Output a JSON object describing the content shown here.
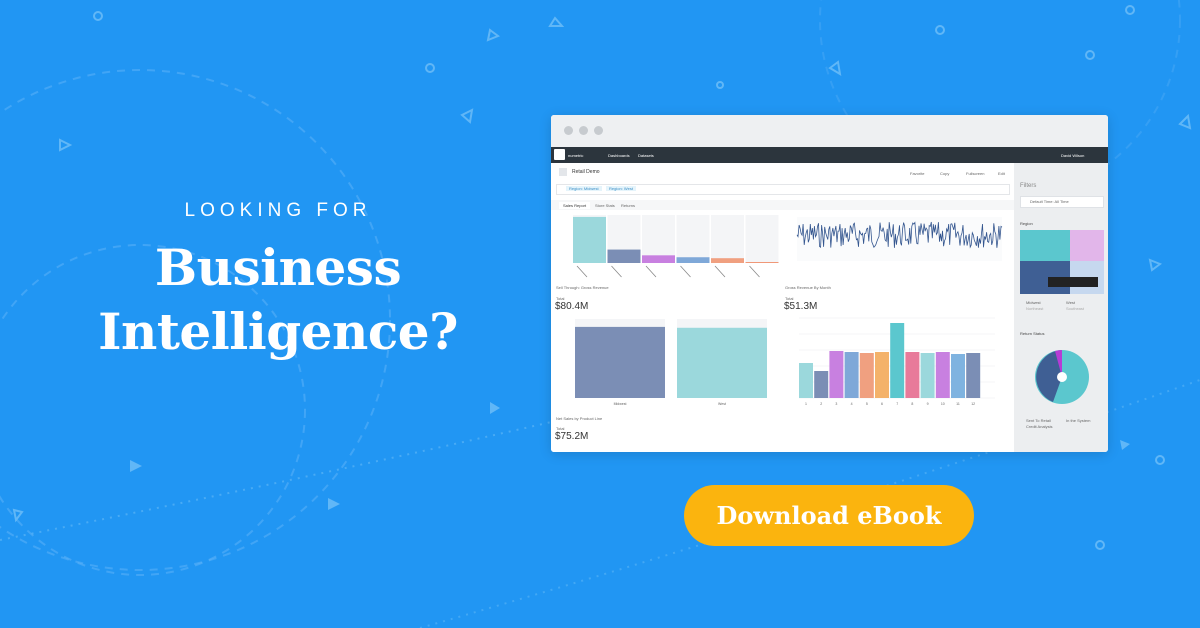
{
  "hero": {
    "kicker": "LOOKING FOR",
    "title_line1": "Business",
    "title_line2": "Intelligence?"
  },
  "cta": {
    "label": "Download eBook"
  },
  "app": {
    "brand": "numetric",
    "nav": [
      "Dashboards",
      "Datasets"
    ],
    "user": "David Wilson",
    "dashboard_title": "Retail Demo",
    "actions": [
      "Favorite",
      "Copy",
      "Fullscreen",
      "Edit"
    ],
    "filter_chips": [
      "Region: Midwest",
      "Region: West"
    ],
    "tabs": [
      "Sales Report",
      "Store Stats",
      "Returns"
    ],
    "charts": {
      "sell_through": {
        "title": "Sell Through: Gross Revenue",
        "total_label": "Total",
        "total": "$80.4M"
      },
      "gross_by_month": {
        "title": "Gross Revenue By Month",
        "total_label": "Total",
        "total": "$51.3M"
      },
      "net_sales": {
        "title": "Net Sales by Product Line",
        "total_label": "Total",
        "total": "$75.2M"
      }
    },
    "sidebar": {
      "panel_title": "Filters",
      "range": "Default Time: All Time",
      "section1": "Region",
      "section2": "Return Status",
      "legend1": [
        "Midwest",
        "West",
        "Northeast",
        "Southeast"
      ],
      "legend2": [
        "Sent To Retail",
        "In the System",
        "Credit Analysis"
      ]
    }
  },
  "chart_data": [
    {
      "type": "bar",
      "categories": [
        "",
        "",
        "",
        "",
        "",
        ""
      ],
      "values": [
        48,
        14,
        8,
        6,
        5,
        1
      ],
      "colors": [
        "#9bd8dc",
        "#7b8eb5",
        "#c880e0",
        "#7fa8d8",
        "#f0a080",
        "#f09878"
      ]
    },
    {
      "type": "bar",
      "title": "Sell Through: Gross Revenue",
      "categories": [
        "Midwest",
        "West"
      ],
      "values": [
        40,
        39.5
      ],
      "ylim": [
        0,
        45
      ]
    },
    {
      "type": "bar",
      "title": "Gross Revenue By Month",
      "categories": [
        "1",
        "2",
        "3",
        "4",
        "5",
        "6",
        "7",
        "8",
        "9",
        "10",
        "11",
        "12"
      ],
      "values": [
        3.5,
        2.7,
        4.7,
        4.6,
        4.5,
        4.6,
        7.5,
        4.6,
        4.5,
        4.6,
        4.4,
        4.5
      ],
      "ylim": [
        0,
        8
      ]
    }
  ],
  "colors": {
    "background": "#2196f3",
    "cta": "#fbb40e",
    "navbar": "#2c353d"
  }
}
